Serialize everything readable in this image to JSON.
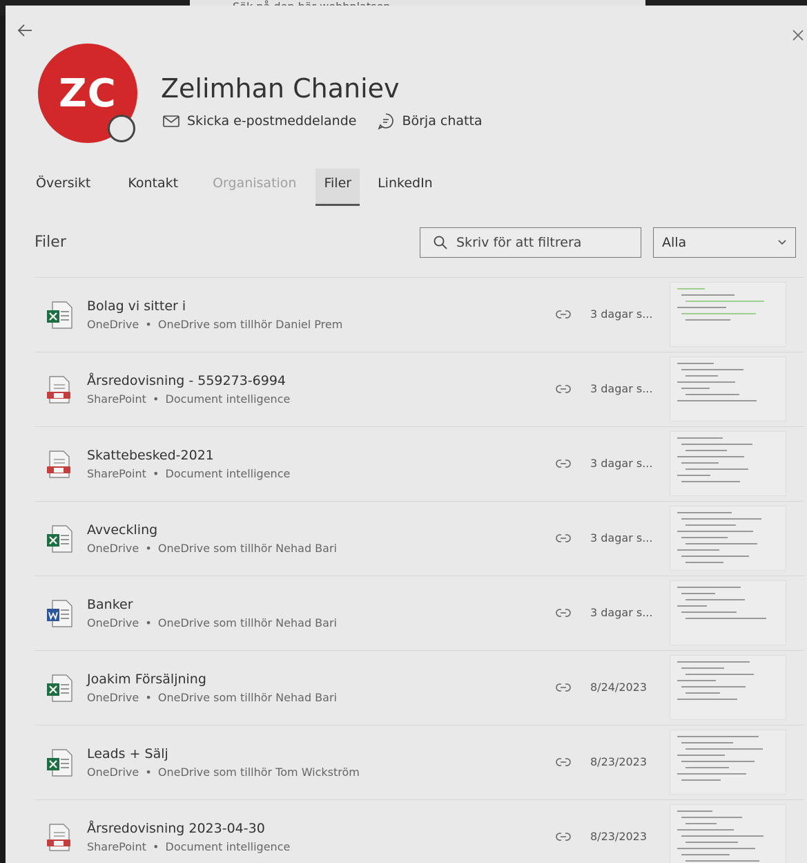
{
  "browser": {
    "search_placeholder": "Sök på den här webbplatsen"
  },
  "profile": {
    "initials": "ZC",
    "name": "Zelimhan Chaniev",
    "avatar_color": "#d2282a",
    "actions": [
      {
        "label": "Skicka e-postmeddelande",
        "icon": "mail-icon"
      },
      {
        "label": "Börja chatta",
        "icon": "chat-icon"
      }
    ]
  },
  "tabs": [
    {
      "label": "Översikt",
      "state": "normal"
    },
    {
      "label": "Kontakt",
      "state": "normal"
    },
    {
      "label": "Organisation",
      "state": "disabled"
    },
    {
      "label": "Filer",
      "state": "active"
    },
    {
      "label": "LinkedIn",
      "state": "normal"
    }
  ],
  "files_section": {
    "title": "Filer",
    "filter_placeholder": "Skriv för att filtrera",
    "dropdown_value": "Alla"
  },
  "files": [
    {
      "title": "Bolag vi sitter i",
      "source": "OneDrive",
      "location": "OneDrive som tillhör Daniel Prem",
      "date": "3 dagar s...",
      "type": "excel"
    },
    {
      "title": "Årsredovisning - 559273-6994",
      "source": "SharePoint",
      "location": "Document intelligence",
      "date": "3 dagar s...",
      "type": "pdf"
    },
    {
      "title": "Skattebesked-2021",
      "source": "SharePoint",
      "location": "Document intelligence",
      "date": "3 dagar s...",
      "type": "pdf"
    },
    {
      "title": "Avveckling",
      "source": "OneDrive",
      "location": "OneDrive som tillhör Nehad Bari",
      "date": "3 dagar s...",
      "type": "excel"
    },
    {
      "title": "Banker",
      "source": "OneDrive",
      "location": "OneDrive som tillhör Nehad Bari",
      "date": "3 dagar s...",
      "type": "word"
    },
    {
      "title": "Joakim Försäljning",
      "source": "OneDrive",
      "location": "OneDrive som tillhör Nehad Bari",
      "date": "8/24/2023",
      "type": "excel"
    },
    {
      "title": "Leads + Sälj",
      "source": "OneDrive",
      "location": "OneDrive som tillhör Tom Wickström",
      "date": "8/23/2023",
      "type": "excel"
    },
    {
      "title": "Årsredovisning 2023-04-30",
      "source": "SharePoint",
      "location": "Document intelligence",
      "date": "8/23/2023",
      "type": "pdf"
    }
  ],
  "separator": "•",
  "colors": {
    "excel": "#1d6f42",
    "word": "#2b579a",
    "pdf": "#c43e3e"
  }
}
